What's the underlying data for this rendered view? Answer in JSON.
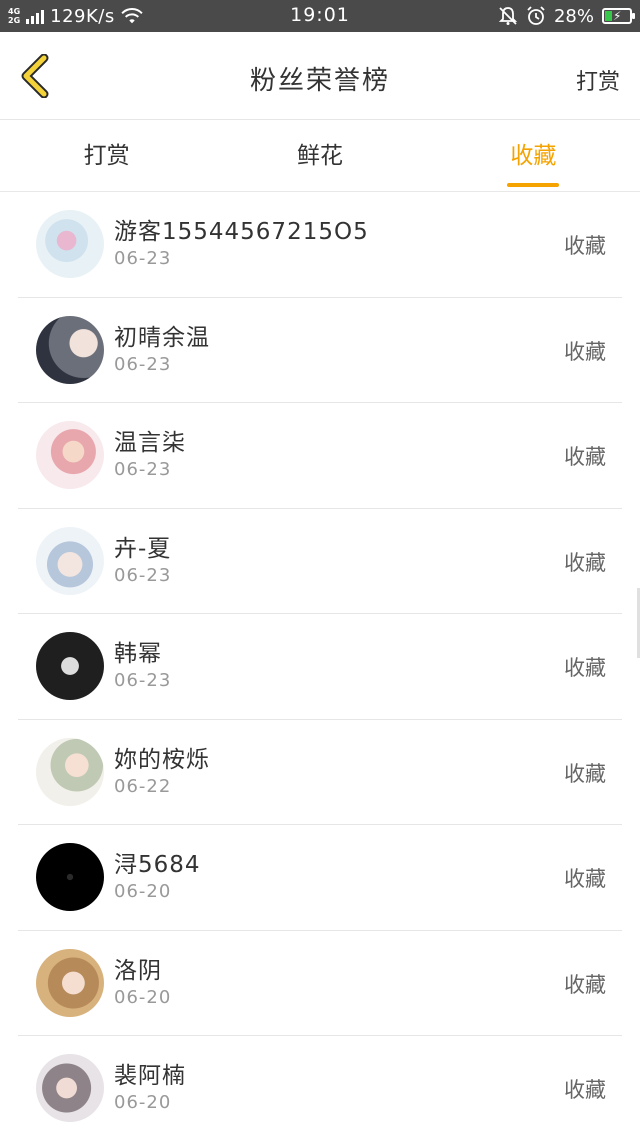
{
  "status_bar": {
    "network_top": "4G",
    "network_bottom": "2G",
    "speed": "129K/s",
    "time": "19:01",
    "battery": "28%",
    "battery_level": 0.28
  },
  "header": {
    "title": "粉丝荣誉榜",
    "action_label": "打赏",
    "back_icon": "chevron-left-icon"
  },
  "tabs": [
    {
      "label": "打赏",
      "active": false
    },
    {
      "label": "鲜花",
      "active": false
    },
    {
      "label": "收藏",
      "active": true
    }
  ],
  "colors": {
    "accent": "#f5a300",
    "status_bar": "#4a4a4a",
    "back_icon_fill": "#f4d23a"
  },
  "list": {
    "items": [
      {
        "name": "游客15544567215O5",
        "date": "06-23",
        "action": "收藏"
      },
      {
        "name": "初晴余温",
        "date": "06-23",
        "action": "收藏"
      },
      {
        "name": "温言柒",
        "date": "06-23",
        "action": "收藏"
      },
      {
        "name": "卉-夏",
        "date": "06-23",
        "action": "收藏"
      },
      {
        "name": "韩幂",
        "date": "06-23",
        "action": "收藏"
      },
      {
        "name": "妳的桉烁",
        "date": "06-22",
        "action": "收藏"
      },
      {
        "name": "浔5684",
        "date": "06-20",
        "action": "收藏"
      },
      {
        "name": "洛阴",
        "date": "06-20",
        "action": "收藏"
      },
      {
        "name": "裴阿楠",
        "date": "06-20",
        "action": "收藏"
      }
    ]
  }
}
